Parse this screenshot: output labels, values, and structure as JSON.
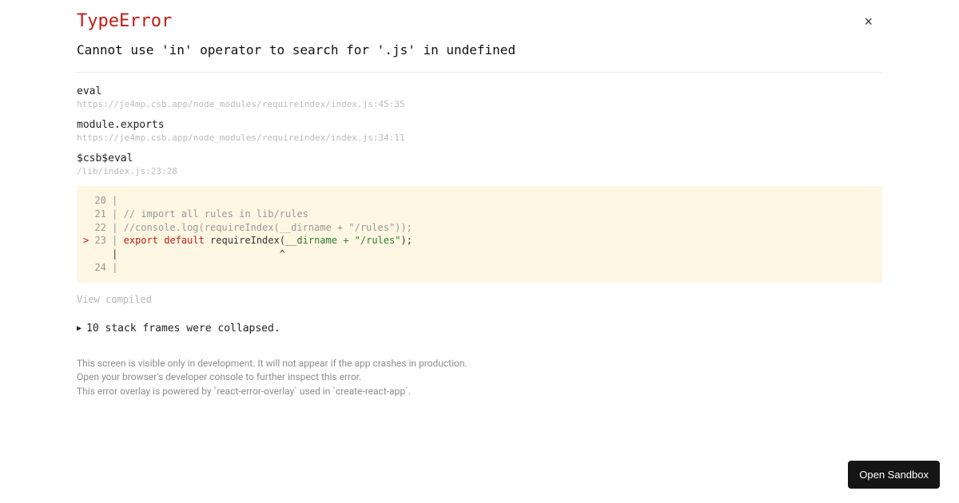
{
  "error": {
    "type": "TypeError",
    "message": "Cannot use 'in' operator to search for '.js' in undefined"
  },
  "frames": [
    {
      "name": "eval",
      "location": "https://je4mp.csb.app/node_modules/requireindex/index.js:45:35"
    },
    {
      "name": "module.exports",
      "location": "https://je4mp.csb.app/node_modules/requireindex/index.js:34:11"
    },
    {
      "name": "$csb$eval",
      "location": "/lib/index.js:23:28"
    }
  ],
  "code": {
    "l20_no": "  20",
    "l21_no": "  21",
    "l21_text": "// import all rules in lib/rules",
    "l22_no": "  22",
    "l22_text": "//console.log(requireIndex(__dirname + \"/rules\"));",
    "l23_marker": ">",
    "l23_no": "23",
    "l23_kw1": "export",
    "l23_kw2": "default",
    "l23_fn": " requireIndex(",
    "l23_var": "__dirname",
    "l23_op": " + ",
    "l23_str": "\"/rules\"",
    "l23_tail": ");",
    "caret_line": "     |                            ^",
    "l24_no": "  24"
  },
  "links": {
    "view_compiled": "View compiled",
    "collapsed": "10 stack frames were collapsed."
  },
  "footer": {
    "line1": "This screen is visible only in development. It will not appear if the app crashes in production.",
    "line2": "Open your browser's developer console to further inspect this error.",
    "line3": "This error overlay is powered by `react-error-overlay` used in `create-react-app`."
  },
  "buttons": {
    "open_sandbox": "Open Sandbox",
    "close": "×"
  }
}
